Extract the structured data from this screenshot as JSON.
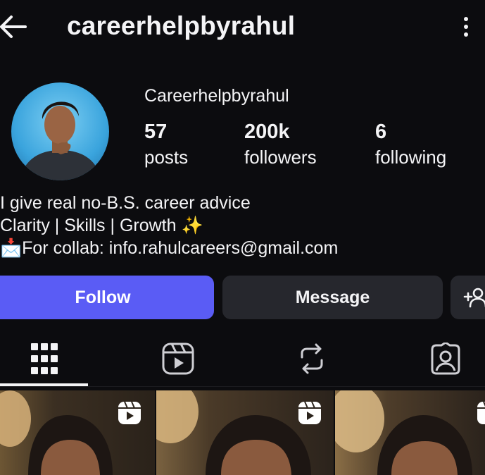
{
  "header": {
    "username": "careerhelpbyrahul",
    "back_icon": "arrow-left-icon",
    "menu_icon": "more-vertical-icon"
  },
  "profile": {
    "display_name": "Careerhelpbyrahul",
    "stats": [
      {
        "value": "57",
        "label": "posts"
      },
      {
        "value": "200k",
        "label": "followers"
      },
      {
        "value": "6",
        "label": "following"
      }
    ],
    "bio": [
      "I give real no-B.S. career advice",
      "Clarity | Skills | Growth ✨",
      "📩For collab: info.rahulcareers@gmail.com"
    ]
  },
  "actions": {
    "follow_label": "Follow",
    "message_label": "Message",
    "add_icon": "add-person-icon"
  },
  "tabs": [
    {
      "icon": "grid-icon",
      "active": true
    },
    {
      "icon": "reels-icon",
      "active": false
    },
    {
      "icon": "reposts-icon",
      "active": false
    },
    {
      "icon": "tagged-icon",
      "active": false
    }
  ],
  "grid": {
    "items": [
      {
        "type": "reel",
        "icon": "reel-icon"
      },
      {
        "type": "reel",
        "icon": "reel-icon"
      },
      {
        "type": "reel",
        "icon": "reel-icon"
      }
    ]
  },
  "colors": {
    "background": "#0c0c0f",
    "follow_button": "#5a5cf5",
    "secondary_button": "#26272d",
    "text": "#f4f4f6"
  }
}
